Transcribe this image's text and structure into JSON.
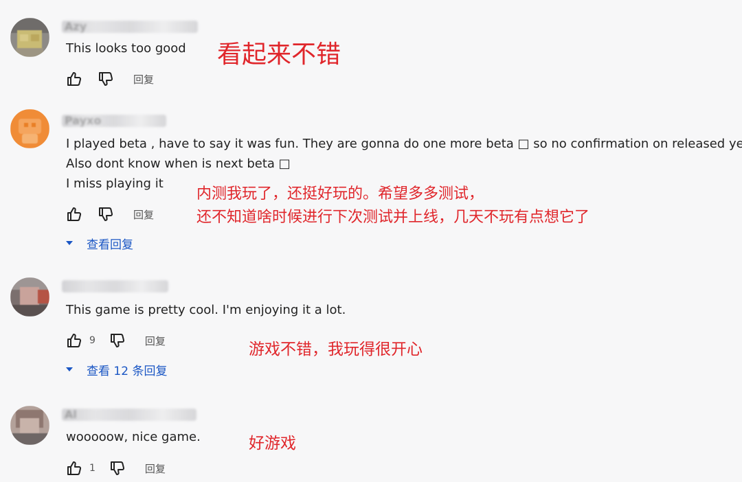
{
  "comments": [
    {
      "username": "Azy",
      "lines": [
        "This looks too good"
      ],
      "likes": "",
      "reply_label": "回复",
      "view_replies": "",
      "translation": [
        "看起来不错"
      ]
    },
    {
      "username": "Payxo",
      "lines": [
        "I played beta , have to say it was fun. They are gonna do one more beta □ so no confirmation on released yet",
        "Also dont know when is next beta □",
        "I miss playing it"
      ],
      "likes": "",
      "reply_label": "回复",
      "view_replies": "查看回复",
      "translation": [
        "内测我玩了，还挺好玩的。希望多多测试，",
        "还不知道啥时候进行下次测试并上线，几天不玩有点想它了"
      ]
    },
    {
      "username": "",
      "lines": [
        "This game is pretty cool. I'm enjoying it a lot."
      ],
      "likes": "9",
      "reply_label": "回复",
      "view_replies": "查看 12 条回复",
      "translation": [
        "游戏不错，我玩得很开心"
      ]
    },
    {
      "username": "Al",
      "lines": [
        "wooooow, nice game."
      ],
      "likes": "1",
      "reply_label": "回复",
      "view_replies": "",
      "translation": [
        "好游戏"
      ]
    }
  ],
  "colors": {
    "annotation": "#e0262b",
    "link": "#1a56c4",
    "background": "#f7f7f8"
  },
  "icons": [
    "thumbs-up-icon",
    "thumbs-down-icon",
    "caret-down-icon"
  ]
}
